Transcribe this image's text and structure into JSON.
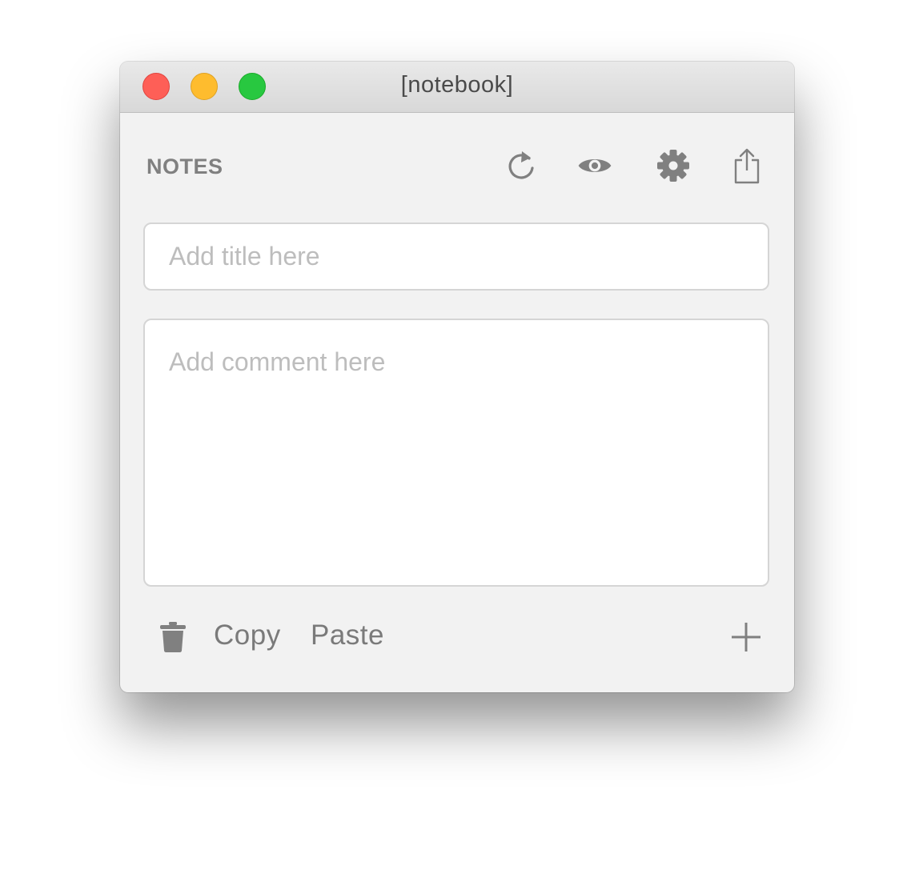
{
  "window": {
    "title": "[notebook]"
  },
  "header": {
    "section_title": "NOTES",
    "icons": [
      "refresh-icon",
      "eye-icon",
      "gear-icon",
      "share-icon"
    ]
  },
  "form": {
    "title_placeholder": "Add title here",
    "title_value": "",
    "comment_placeholder": "Add comment here",
    "comment_value": ""
  },
  "footer": {
    "copy_label": "Copy",
    "paste_label": "Paste",
    "icons": [
      "trash-icon",
      "plus-icon"
    ]
  },
  "colors": {
    "window_bg": "#f2f2f2",
    "icon": "#808080",
    "close": "#fe5f57",
    "minimize": "#febc2e",
    "zoom": "#28c840"
  }
}
